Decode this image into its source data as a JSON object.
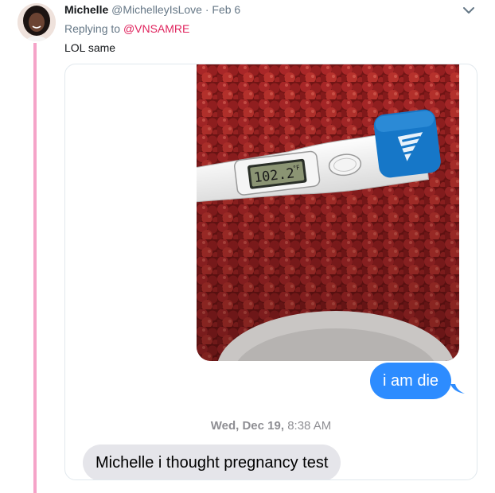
{
  "tweet": {
    "author_name": "Michelle",
    "author_handle": "@MichelleyIsLove",
    "separator": "·",
    "date": "Feb 6",
    "replying_prefix": "Replying to",
    "replying_to": "@VNSAMRE",
    "text": "LOL same"
  },
  "media": {
    "thermometer_reading": "102.2",
    "thermometer_unit": "°F",
    "sent_message": "i am die",
    "timestamp_day": "Wed, Dec 19,",
    "timestamp_time": "8:38 AM",
    "received_message": "Michelle i thought pregnancy test"
  },
  "colors": {
    "thread_line": "#f5a3c8",
    "mention": "#e0245e",
    "sent_bubble": "#2d8cff",
    "received_bubble": "#e5e5ea"
  },
  "icons": [
    "chevron-down-icon"
  ]
}
